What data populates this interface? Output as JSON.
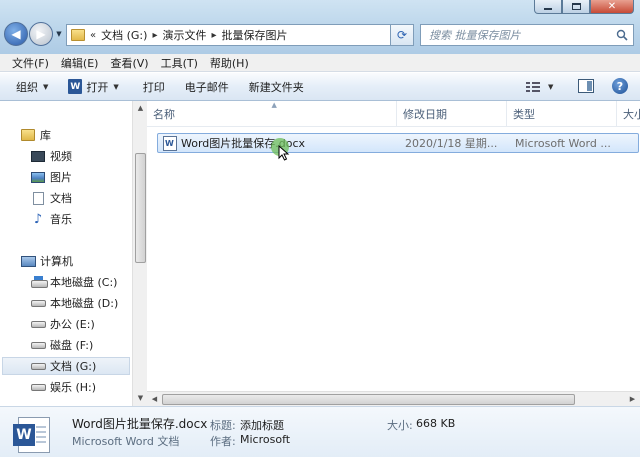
{
  "window": {
    "min_symbol": "",
    "max_symbol": "",
    "close_symbol": "✕"
  },
  "nav": {
    "back_symbol": "◀",
    "forward_symbol": "▶"
  },
  "address": {
    "overflow": "«",
    "crumbs": [
      "文档 (G:)",
      "演示文件",
      "批量保存图片"
    ]
  },
  "search": {
    "placeholder": "搜索 批量保存图片"
  },
  "menubar": [
    "文件(F)",
    "编辑(E)",
    "查看(V)",
    "工具(T)",
    "帮助(H)"
  ],
  "toolbar": {
    "organize": "组织",
    "open": "打开",
    "print": "打印",
    "email": "电子邮件",
    "new_folder": "新建文件夹",
    "word_badge": "W",
    "help": "?"
  },
  "sidebar": {
    "library": "库",
    "library_items": [
      "视频",
      "图片",
      "文档",
      "音乐"
    ],
    "computer": "计算机",
    "drives": [
      "本地磁盘 (C:)",
      "本地磁盘 (D:)",
      "办公 (E:)",
      "磁盘 (F:)",
      "文档 (G:)",
      "娱乐 (H:)"
    ],
    "selected_drive": "文档 (G:)"
  },
  "columns": [
    "名称",
    "修改日期",
    "类型",
    "大小"
  ],
  "files": [
    {
      "name": "Word图片批量保存.docx",
      "modified": "2020/1/18 星期...",
      "type": "Microsoft Word ..."
    }
  ],
  "details": {
    "filename": "Word图片批量保存.docx",
    "filetype": "Microsoft Word 文档",
    "title_label": "标题:",
    "title_value": "添加标题",
    "author_label": "作者:",
    "author_value": "Microsoft",
    "size_label": "大小:",
    "size_value": "668 KB",
    "icon_letter": "W"
  },
  "colors": {
    "accent": "#2b5797",
    "selection_bg": "#d3e6fb",
    "selection_border": "#84acdd",
    "cursor_highlight": "#6ebe5a"
  }
}
